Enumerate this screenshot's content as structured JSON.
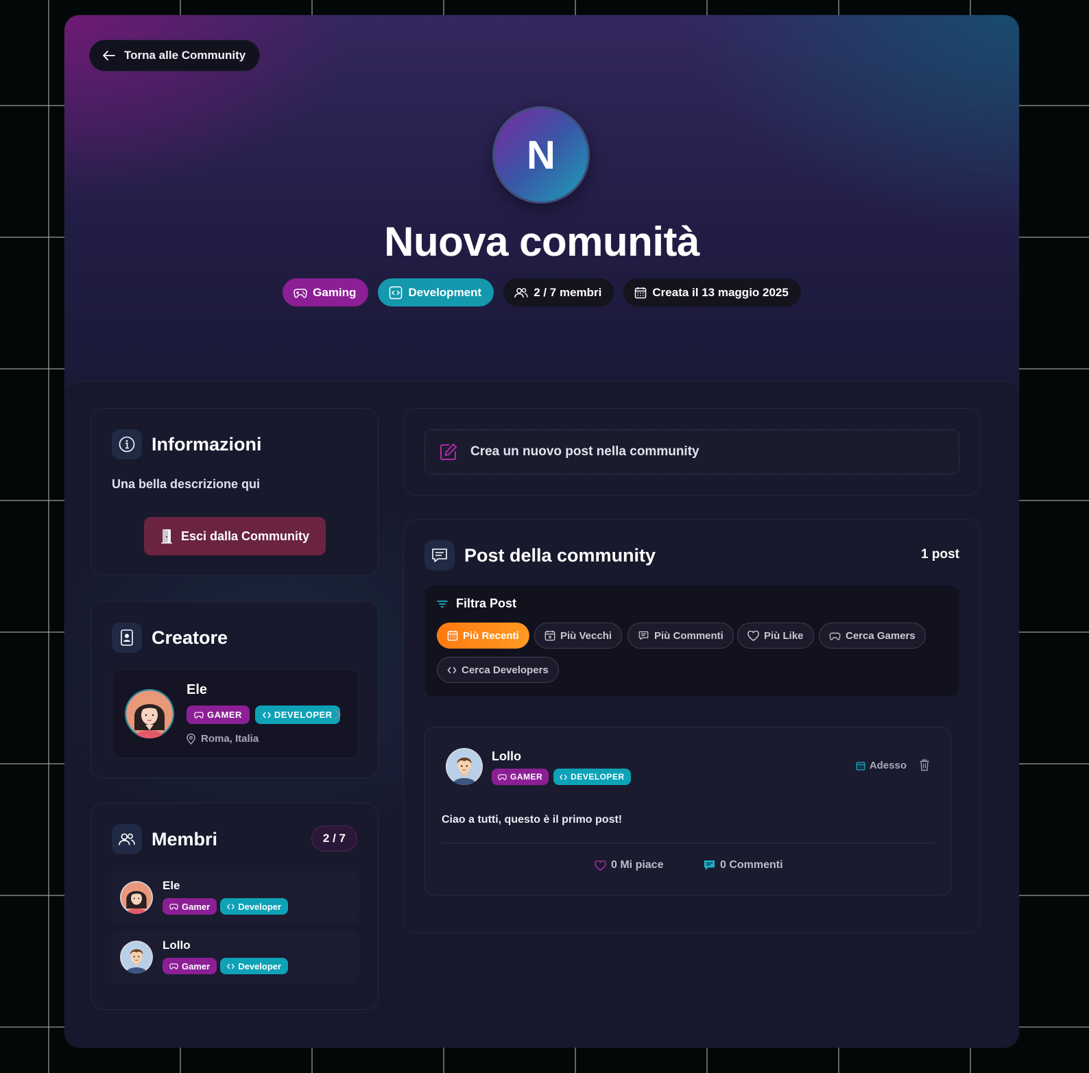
{
  "header": {
    "back_label": "Torna alle Community",
    "avatar_letter": "N",
    "title": "Nuova comunità",
    "chips": {
      "gaming": "Gaming",
      "development": "Development",
      "members": "2 / 7 membri",
      "created": "Creata il 13 maggio 2025"
    }
  },
  "info": {
    "title": "Informazioni",
    "description": "Una bella descrizione qui",
    "leave_label": "Esci dalla Community"
  },
  "creator": {
    "title": "Creatore",
    "name": "Ele",
    "tags": [
      "GAMER",
      "DEVELOPER"
    ],
    "location": "Roma, Italia"
  },
  "members": {
    "title": "Membri",
    "count": "2 / 7",
    "list": [
      {
        "name": "Ele",
        "tags": [
          "Gamer",
          "Developer"
        ]
      },
      {
        "name": "Lollo",
        "tags": [
          "Gamer",
          "Developer"
        ]
      }
    ]
  },
  "composer": {
    "placeholder": "Crea un nuovo post nella community"
  },
  "posts": {
    "title": "Post della community",
    "count": "1 post",
    "filter_title": "Filtra Post",
    "filters": [
      "Più Recenti",
      "Più Vecchi",
      "Più Commenti",
      "Più Like",
      "Cerca Gamers",
      "Cerca Developers"
    ],
    "items": [
      {
        "author": "Lollo",
        "tags": [
          "GAMER",
          "DEVELOPER"
        ],
        "time": "Adesso",
        "text": "Ciao a tutti, questo è il primo post!",
        "likes": "0 Mi piace",
        "comments": "0 Commenti"
      }
    ]
  },
  "colors": {
    "gamer": "#8c1f95",
    "developer": "#0ea2b7",
    "active_filter": "#ff8a1a",
    "leave": "#6a2440"
  }
}
